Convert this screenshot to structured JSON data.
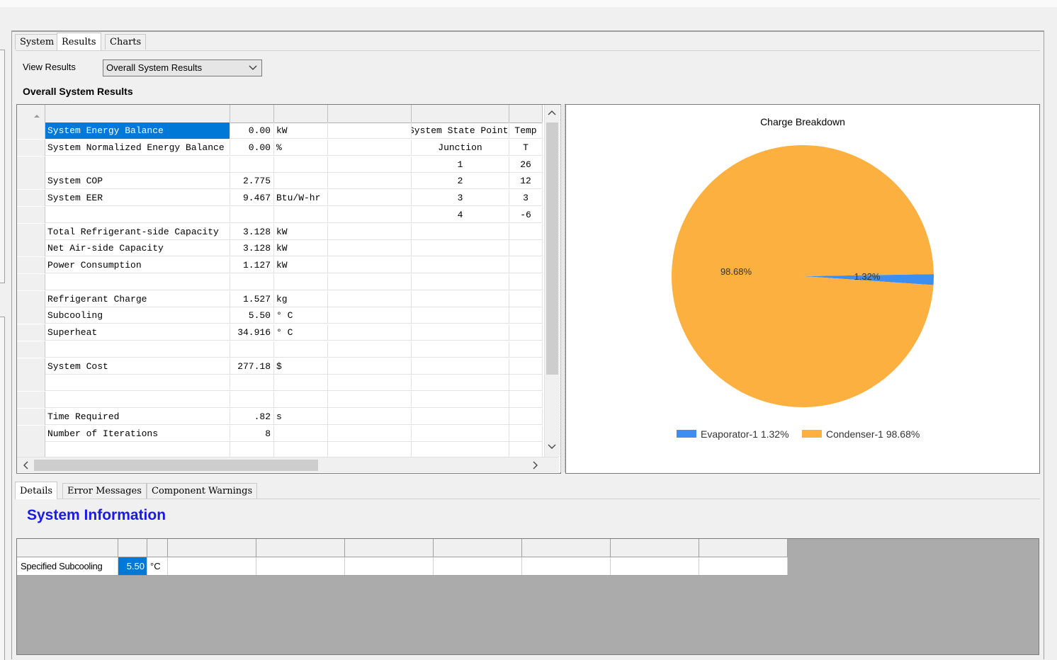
{
  "tabs_top": [
    "System",
    "Results",
    "Charts"
  ],
  "view_results": {
    "label": "View Results",
    "selected": "Overall System Results"
  },
  "section_title": "Overall System Results",
  "grid_rows": [
    {
      "label": "System Energy Balance",
      "value": "0.00",
      "unit": "kW",
      "junction": "System State Points",
      "temp": "Temp"
    },
    {
      "label": "System Normalized Energy Balance",
      "value": "0.00",
      "unit": "%",
      "junction": "Junction",
      "temp": "T"
    },
    {
      "label": "",
      "value": "",
      "unit": "",
      "junction": "1",
      "temp": "26"
    },
    {
      "label": "System COP",
      "value": "2.775",
      "unit": "",
      "junction": "2",
      "temp": "12"
    },
    {
      "label": "System EER",
      "value": "9.467",
      "unit": "Btu/W-hr",
      "junction": "3",
      "temp": "3"
    },
    {
      "label": "",
      "value": "",
      "unit": "",
      "junction": "4",
      "temp": "-6"
    },
    {
      "label": "Total Refrigerant-side Capacity",
      "value": "3.128",
      "unit": "kW",
      "junction": "",
      "temp": ""
    },
    {
      "label": "Net Air-side Capacity",
      "value": "3.128",
      "unit": "kW",
      "junction": "",
      "temp": ""
    },
    {
      "label": "Power Consumption",
      "value": "1.127",
      "unit": "kW",
      "junction": "",
      "temp": ""
    },
    {
      "label": "",
      "value": "",
      "unit": "",
      "junction": "",
      "temp": ""
    },
    {
      "label": "Refrigerant Charge",
      "value": "1.527",
      "unit": "kg",
      "junction": "",
      "temp": ""
    },
    {
      "label": "Subcooling",
      "value": "5.50",
      "unit": "° C",
      "junction": "",
      "temp": ""
    },
    {
      "label": "Superheat",
      "value": "34.916",
      "unit": "° C",
      "junction": "",
      "temp": ""
    },
    {
      "label": "",
      "value": "",
      "unit": "",
      "junction": "",
      "temp": ""
    },
    {
      "label": "System Cost",
      "value": "277.18",
      "unit": "$",
      "junction": "",
      "temp": ""
    },
    {
      "label": "",
      "value": "",
      "unit": "",
      "junction": "",
      "temp": ""
    },
    {
      "label": "",
      "value": "",
      "unit": "",
      "junction": "",
      "temp": ""
    },
    {
      "label": "Time Required",
      "value": ".82",
      "unit": "s",
      "junction": "",
      "temp": ""
    },
    {
      "label": "Number of Iterations",
      "value": "8",
      "unit": "",
      "junction": "",
      "temp": ""
    },
    {
      "label": "",
      "value": "",
      "unit": "",
      "junction": "",
      "temp": ""
    }
  ],
  "chart_data": {
    "type": "pie",
    "title": "Charge Breakdown",
    "slices": [
      {
        "name": "Evaporator-1",
        "value": 1.32,
        "label": "1.32%",
        "legend": "Evaporator-1  1.32%",
        "color": "#3d8ef0"
      },
      {
        "name": "Condenser-1",
        "value": 98.68,
        "label": "98.68%",
        "legend": "Condenser-1  98.68%",
        "color": "#fbb040"
      }
    ],
    "legend_position": "bottom"
  },
  "tabs_bottom": [
    "Details",
    "Error Messages",
    "Component Warnings"
  ],
  "system_information": {
    "title": "System Information",
    "row": {
      "label": "Specified Subcooling",
      "value": "5.50",
      "unit": "°C"
    }
  }
}
